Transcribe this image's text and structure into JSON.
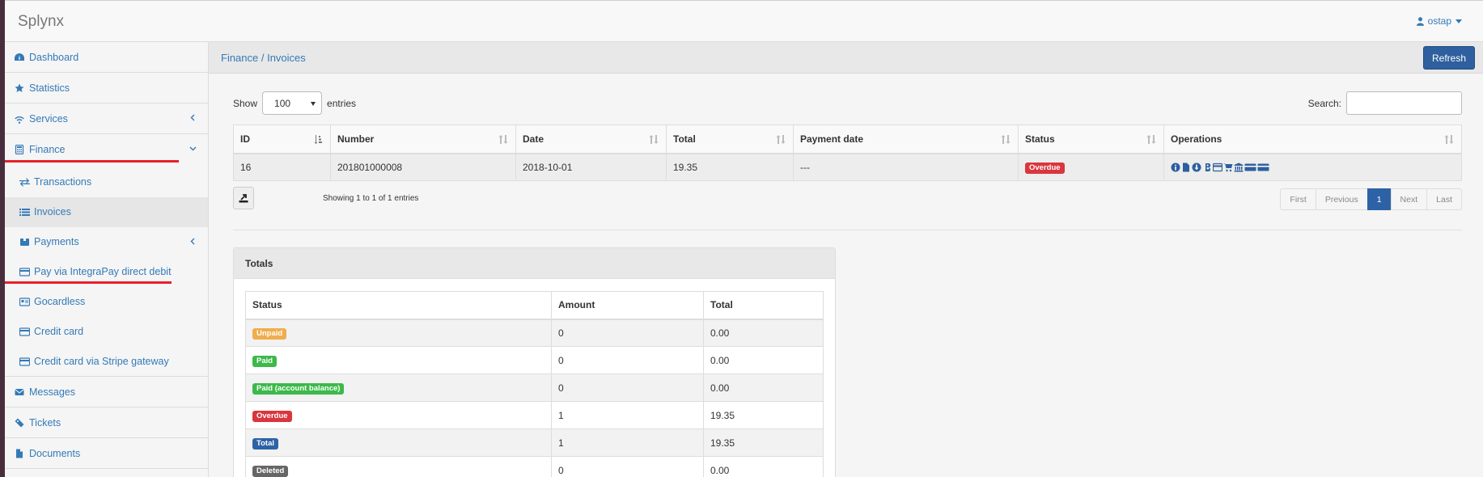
{
  "app": {
    "brand": "Splynx",
    "user": "ostap"
  },
  "sidebar": {
    "items": [
      {
        "label": "Dashboard",
        "icon": "dashboard-icon"
      },
      {
        "label": "Statistics",
        "icon": "star-icon"
      },
      {
        "label": "Services",
        "icon": "wifi-icon"
      },
      {
        "label": "Finance",
        "icon": "calculator-icon"
      }
    ],
    "finance_sub": [
      {
        "label": "Transactions",
        "icon": "exchange-icon"
      },
      {
        "label": "Invoices",
        "icon": "list-icon"
      },
      {
        "label": "Payments",
        "icon": "box-icon"
      },
      {
        "label": "Pay via IntegraPay direct debit",
        "icon": "credit-card-icon"
      },
      {
        "label": "Gocardless",
        "icon": "id-card-icon"
      },
      {
        "label": "Credit card",
        "icon": "credit-card-icon"
      },
      {
        "label": "Credit card via Stripe gateway",
        "icon": "credit-card-icon"
      }
    ],
    "bottom_items": [
      {
        "label": "Messages",
        "icon": "envelope-icon"
      },
      {
        "label": "Tickets",
        "icon": "ticket-icon"
      },
      {
        "label": "Documents",
        "icon": "file-icon"
      }
    ]
  },
  "header": {
    "breadcrumb": "Finance / Invoices",
    "refresh_label": "Refresh"
  },
  "list_controls": {
    "show_label": "Show",
    "entries_value": "100",
    "entries_label": "entries",
    "search_label": "Search:",
    "search_value": ""
  },
  "invoices_table": {
    "columns": [
      "ID",
      "Number",
      "Date",
      "Total",
      "Payment date",
      "Status",
      "Operations"
    ],
    "rows": [
      {
        "id": "16",
        "number": "201801000008",
        "date": "2018-10-01",
        "total": "19.35",
        "payment_date": "---",
        "status": "Overdue"
      }
    ],
    "operation_icons": [
      "info-icon",
      "file-icon",
      "download-icon",
      "bitcoin-icon",
      "credit-card-icon",
      "cart-icon",
      "bank-icon",
      "card-icon",
      "card-icon"
    ]
  },
  "table_info": "Showing 1 to 1 of 1 entries",
  "pagination": {
    "first": "First",
    "previous": "Previous",
    "current": "1",
    "next": "Next",
    "last": "Last"
  },
  "totals": {
    "title": "Totals",
    "columns": [
      "Status",
      "Amount",
      "Total"
    ],
    "rows": [
      {
        "status": "Unpaid",
        "amount": "0",
        "total": "0.00",
        "color": "#f0ad4e"
      },
      {
        "status": "Paid",
        "amount": "0",
        "total": "0.00",
        "color": "#3cb94a"
      },
      {
        "status": "Paid (account balance)",
        "amount": "0",
        "total": "0.00",
        "color": "#3cb94a"
      },
      {
        "status": "Overdue",
        "amount": "1",
        "total": "19.35",
        "color": "#d9363e"
      },
      {
        "status": "Total",
        "amount": "1",
        "total": "19.35",
        "color": "#2e62a6"
      },
      {
        "status": "Deleted",
        "amount": "0",
        "total": "0.00",
        "color": "#666666"
      }
    ]
  },
  "colors": {
    "link": "#337ab7",
    "primary": "#2e5f9e",
    "overdue": "#d9363e",
    "highlight_line": "#e8202a"
  }
}
